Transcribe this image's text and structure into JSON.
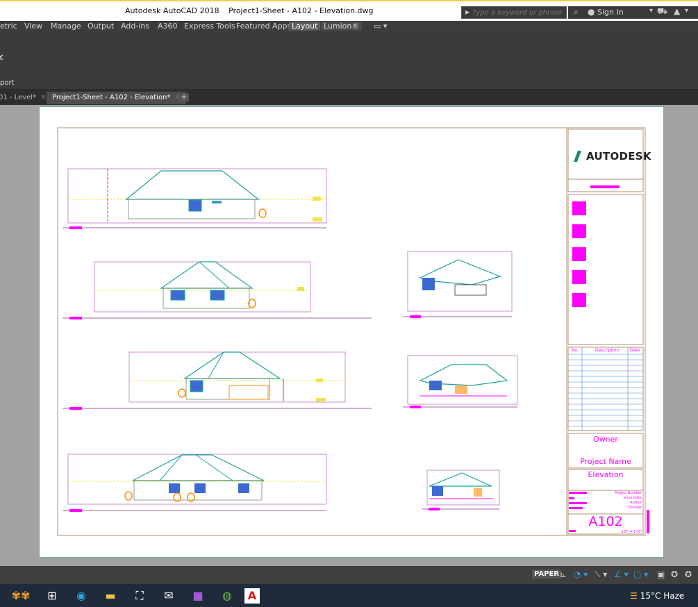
{
  "titlebar": {
    "app_name": "Autodesk AutoCAD 2018",
    "file_name": "Project1-Sheet - A102 - Elevation.dwg",
    "search_placeholder": "Type a keyword or phrase",
    "sign_in": "Sign In"
  },
  "menu": {
    "items": [
      "etric",
      "View",
      "Manage",
      "Output",
      "Add-ins",
      "A360",
      "Express Tools",
      "Featured Apps",
      "Layout",
      "Lumion®"
    ],
    "active": "Layout"
  },
  "ribbon": {
    "panel_label": "port",
    "icon": "export-icon"
  },
  "doc_tabs": {
    "tabs": [
      "01 - Level*",
      "Project1-Sheet - A102 - Elevation*"
    ],
    "active_index": 1
  },
  "title_block": {
    "logo_text": "AUTODESK",
    "owner": "Owner",
    "project_name": "Project Name",
    "sheet_title": "Elevation",
    "revision_headers": [
      "No.",
      "Description",
      "Date"
    ],
    "project_number": "Project Number",
    "issue_date": "Issue Date",
    "author": "Author",
    "checker": "Checker",
    "sheet_number": "A102",
    "scale": "1/8\" = 1'-0\""
  },
  "statusbar": {
    "space": "PAPER"
  },
  "taskbar": {
    "weather": "15°C  Haze",
    "apps": [
      "task-view-icon",
      "edge-icon",
      "file-explorer-icon",
      "store-icon",
      "mail-icon",
      "onenote-icon",
      "utorrent-icon",
      "autocad-icon"
    ]
  },
  "colors": {
    "roof": "#1aa39a",
    "magenta": "#ff00ff",
    "yellow": "#f0e44a",
    "orange": "#ff8c00",
    "border": "#b09070"
  }
}
